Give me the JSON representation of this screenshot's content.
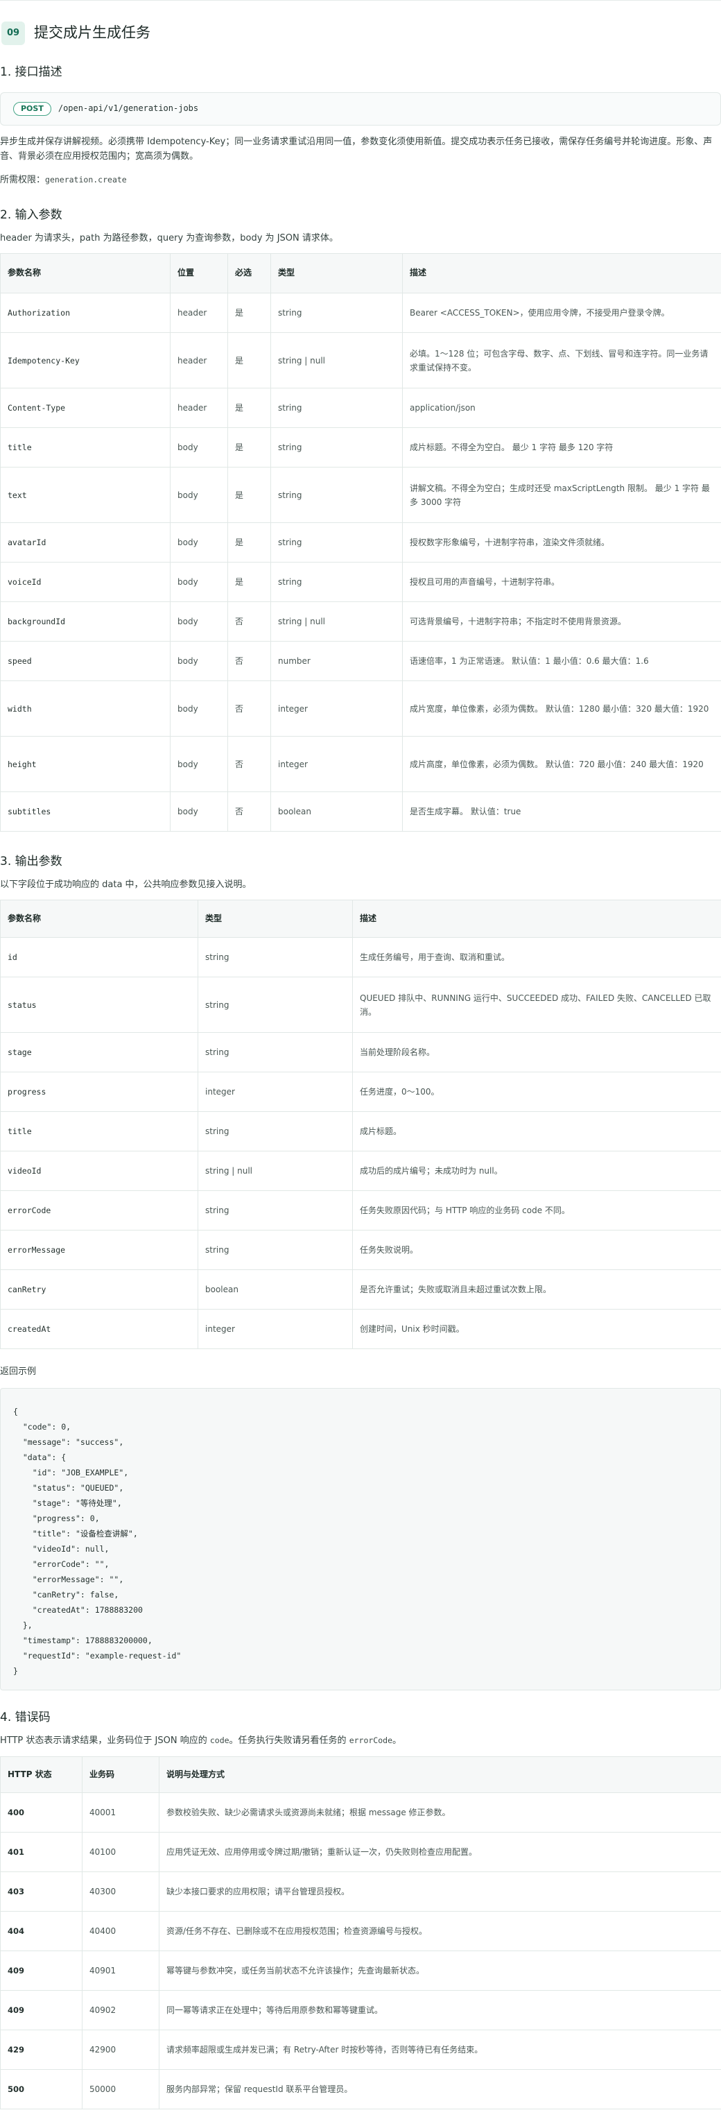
{
  "header": {
    "num": "09",
    "title": "提交成片生成任务"
  },
  "section1": {
    "title": "1. 接口描述",
    "method": "POST",
    "path": "/open-api/v1/generation-jobs",
    "desc": "异步生成并保存讲解视频。必须携带 Idempotency-Key；同一业务请求重试沿用同一值，参数变化须使用新值。提交成功表示任务已接收，需保存任务编号并轮询进度。形象、声音、背景必须在应用授权范围内；宽高须为偶数。",
    "perm_label": "所需权限：",
    "perm_value": "generation.create"
  },
  "section2": {
    "title": "2. 输入参数",
    "desc": "header 为请求头，path 为路径参数，query 为查询参数，body 为 JSON 请求体。",
    "headers": [
      "参数名称",
      "位置",
      "必选",
      "类型",
      "描述"
    ],
    "rows": [
      {
        "name": "Authorization",
        "loc": "header",
        "req": "是",
        "type": "string",
        "desc": "Bearer <ACCESS_TOKEN>，使用应用令牌，不接受用户登录令牌。"
      },
      {
        "name": "Idempotency-Key",
        "loc": "header",
        "req": "是",
        "type": "string | null",
        "desc": "必填。1～128 位；可包含字母、数字、点、下划线、冒号和连字符。同一业务请求重试保持不变。"
      },
      {
        "name": "Content-Type",
        "loc": "header",
        "req": "是",
        "type": "string",
        "desc": "application/json"
      },
      {
        "name": "title",
        "loc": "body",
        "req": "是",
        "type": "string",
        "desc": "成片标题。不得全为空白。 最少 1 字符 最多 120 字符"
      },
      {
        "name": "text",
        "loc": "body",
        "req": "是",
        "type": "string",
        "desc": "讲解文稿。不得全为空白；生成时还受 maxScriptLength 限制。 最少 1 字符 最多 3000 字符"
      },
      {
        "name": "avatarId",
        "loc": "body",
        "req": "是",
        "type": "string",
        "desc": "授权数字形象编号，十进制字符串，渲染文件须就绪。"
      },
      {
        "name": "voiceId",
        "loc": "body",
        "req": "是",
        "type": "string",
        "desc": "授权且可用的声音编号，十进制字符串。"
      },
      {
        "name": "backgroundId",
        "loc": "body",
        "req": "否",
        "type": "string | null",
        "desc": "可选背景编号，十进制字符串；不指定时不使用背景资源。"
      },
      {
        "name": "speed",
        "loc": "body",
        "req": "否",
        "type": "number",
        "desc": "语速倍率，1 为正常语速。 默认值：1 最小值：0.6 最大值：1.6"
      },
      {
        "name": "width",
        "loc": "body",
        "req": "否",
        "type": "integer",
        "desc": "成片宽度，单位像素，必须为偶数。 默认值：1280 最小值：320 最大值：1920"
      },
      {
        "name": "height",
        "loc": "body",
        "req": "否",
        "type": "integer",
        "desc": "成片高度，单位像素，必须为偶数。 默认值：720 最小值：240 最大值：1920"
      },
      {
        "name": "subtitles",
        "loc": "body",
        "req": "否",
        "type": "boolean",
        "desc": "是否生成字幕。 默认值：true"
      }
    ]
  },
  "section3": {
    "title": "3. 输出参数",
    "desc": "以下字段位于成功响应的 data 中，公共响应参数见接入说明。",
    "headers": [
      "参数名称",
      "类型",
      "描述"
    ],
    "rows": [
      {
        "name": "id",
        "type": "string",
        "desc": "生成任务编号，用于查询、取消和重试。"
      },
      {
        "name": "status",
        "type": "string",
        "desc": "QUEUED 排队中、RUNNING 运行中、SUCCEEDED 成功、FAILED 失败、CANCELLED 已取消。"
      },
      {
        "name": "stage",
        "type": "string",
        "desc": "当前处理阶段名称。"
      },
      {
        "name": "progress",
        "type": "integer",
        "desc": "任务进度，0～100。"
      },
      {
        "name": "title",
        "type": "string",
        "desc": "成片标题。"
      },
      {
        "name": "videoId",
        "type": "string | null",
        "desc": "成功后的成片编号；未成功时为 null。"
      },
      {
        "name": "errorCode",
        "type": "string",
        "desc": "任务失败原因代码；与 HTTP 响应的业务码 code 不同。"
      },
      {
        "name": "errorMessage",
        "type": "string",
        "desc": "任务失败说明。"
      },
      {
        "name": "canRetry",
        "type": "boolean",
        "desc": "是否允许重试；失败或取消且未超过重试次数上限。"
      },
      {
        "name": "createdAt",
        "type": "integer",
        "desc": "创建时间，Unix 秒时间戳。"
      }
    ],
    "example_label": "返回示例",
    "example_code": "{\n  \"code\": 0,\n  \"message\": \"success\",\n  \"data\": {\n    \"id\": \"JOB_EXAMPLE\",\n    \"status\": \"QUEUED\",\n    \"stage\": \"等待处理\",\n    \"progress\": 0,\n    \"title\": \"设备检查讲解\",\n    \"videoId\": null,\n    \"errorCode\": \"\",\n    \"errorMessage\": \"\",\n    \"canRetry\": false,\n    \"createdAt\": 1788883200\n  },\n  \"timestamp\": 1788883200000,\n  \"requestId\": \"example-request-id\"\n}"
  },
  "section4": {
    "title": "4. 错误码",
    "desc_a": "HTTP 状态表示请求结果，业务码位于 JSON 响应的 ",
    "desc_code1": "code",
    "desc_b": "。任务执行失败请另看任务的 ",
    "desc_code2": "errorCode",
    "desc_c": "。",
    "headers": [
      "HTTP 状态",
      "业务码",
      "说明与处理方式"
    ],
    "rows": [
      {
        "http": "400",
        "code": "40001",
        "desc": "参数校验失败、缺少必需请求头或资源尚未就绪；根据 message 修正参数。"
      },
      {
        "http": "401",
        "code": "40100",
        "desc": "应用凭证无效、应用停用或令牌过期/撤销；重新认证一次，仍失败则检查应用配置。"
      },
      {
        "http": "403",
        "code": "40300",
        "desc": "缺少本接口要求的应用权限；请平台管理员授权。"
      },
      {
        "http": "404",
        "code": "40400",
        "desc": "资源/任务不存在、已删除或不在应用授权范围；检查资源编号与授权。"
      },
      {
        "http": "409",
        "code": "40901",
        "desc": "幂等键与参数冲突，或任务当前状态不允许该操作；先查询最新状态。"
      },
      {
        "http": "409",
        "code": "40902",
        "desc": "同一幂等请求正在处理中；等待后用原参数和幂等键重试。"
      },
      {
        "http": "429",
        "code": "42900",
        "desc": "请求频率超限或生成并发已满；有 Retry-After 时按秒等待，否则等待已有任务结束。"
      },
      {
        "http": "500",
        "code": "50000",
        "desc": "服务内部异常；保留 requestId 联系平台管理员。"
      }
    ]
  }
}
